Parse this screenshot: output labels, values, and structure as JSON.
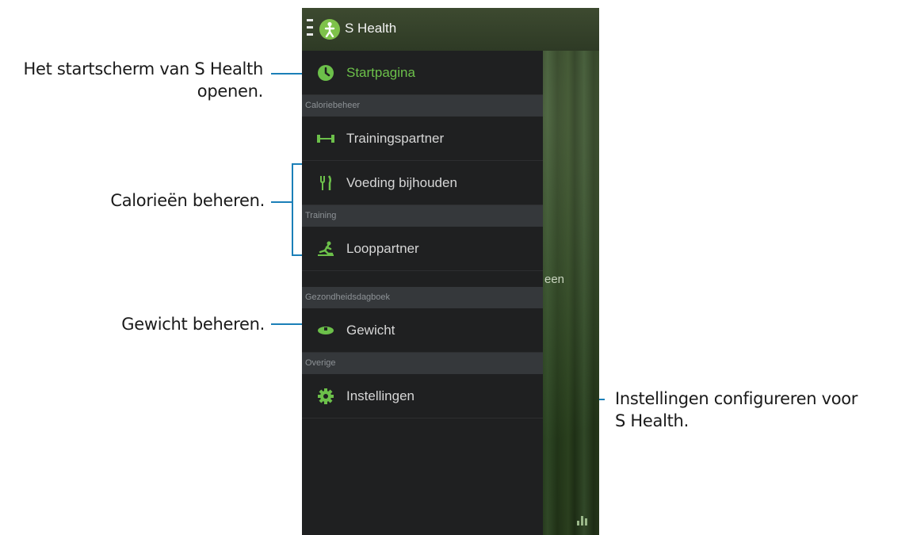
{
  "callouts": {
    "home_line1": "Het startscherm van S Health",
    "home_line2": "openen.",
    "calories": "Calorieën beheren.",
    "weight": "Gewicht beheren.",
    "settings_line1": "Instellingen configureren voor",
    "settings_line2": "S Health."
  },
  "app": {
    "title": "S Health",
    "background_text": "een"
  },
  "drawer": {
    "home": "Startpagina",
    "section_calories": "Calorie­beheer",
    "training_partner": "Trainingspartner",
    "food": "Voeding bijhouden",
    "section_training": "Training",
    "walking": "Looppartner",
    "section_diary": "Gezondheidsdagboek",
    "weight": "Gewicht",
    "section_other": "Overige",
    "settings": "Instellingen"
  },
  "icons": {
    "home": "home-icon",
    "training_partner": "dumbbell-icon",
    "food": "cutlery-icon",
    "walking": "walker-icon",
    "weight": "scale-icon",
    "settings": "gear-icon"
  },
  "colors": {
    "accent": "#6cc04a",
    "callout_line": "#1b7fb8",
    "drawer_bg": "#1f2021",
    "section_bg": "#35383b"
  }
}
